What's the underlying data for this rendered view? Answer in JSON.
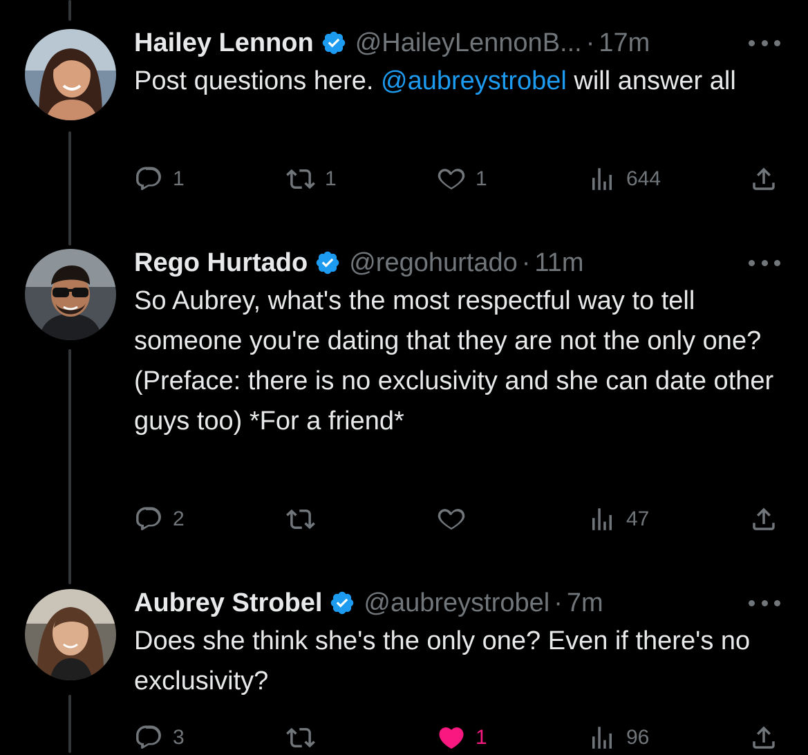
{
  "tweets": [
    {
      "display_name": "Hailey Lennon",
      "handle": "@HaileyLennonB...",
      "dot": "·",
      "time": "17m",
      "text_lines": [],
      "text_before": "Post questions here. ",
      "mention": "@aubreystrobel",
      "text_after": " will answer all",
      "replies": "1",
      "retweets": "1",
      "likes": "1",
      "views": "644",
      "liked": false
    },
    {
      "display_name": "Rego Hurtado",
      "handle": "@regohurtado",
      "dot": "·",
      "time": "11m",
      "text": "So Aubrey, what's the most respectful way to tell someone you're dating that they are not the only one? (Preface: there is no exclusivity and she can date other guys too) *For a friend*",
      "replies": "2",
      "retweets": "",
      "likes": "",
      "views": "47",
      "liked": false
    },
    {
      "display_name": "Aubrey Strobel",
      "handle": "@aubreystrobel",
      "dot": "·",
      "time": "7m",
      "text": "Does she think she's the only one? Even if there's no exclusivity?",
      "replies": "3",
      "retweets": "",
      "likes": "1",
      "views": "96",
      "liked": true
    }
  ],
  "icons": {
    "reply": "reply-icon",
    "retweet": "retweet-icon",
    "like": "heart-icon",
    "views": "views-icon",
    "share": "share-icon",
    "verified": "verified-badge-icon",
    "more": "more-icon"
  },
  "colors": {
    "background": "#000000",
    "text": "#e7e9ea",
    "muted": "#71767b",
    "link": "#1d9bf0",
    "like": "#f91880",
    "thread_line": "#333639"
  }
}
